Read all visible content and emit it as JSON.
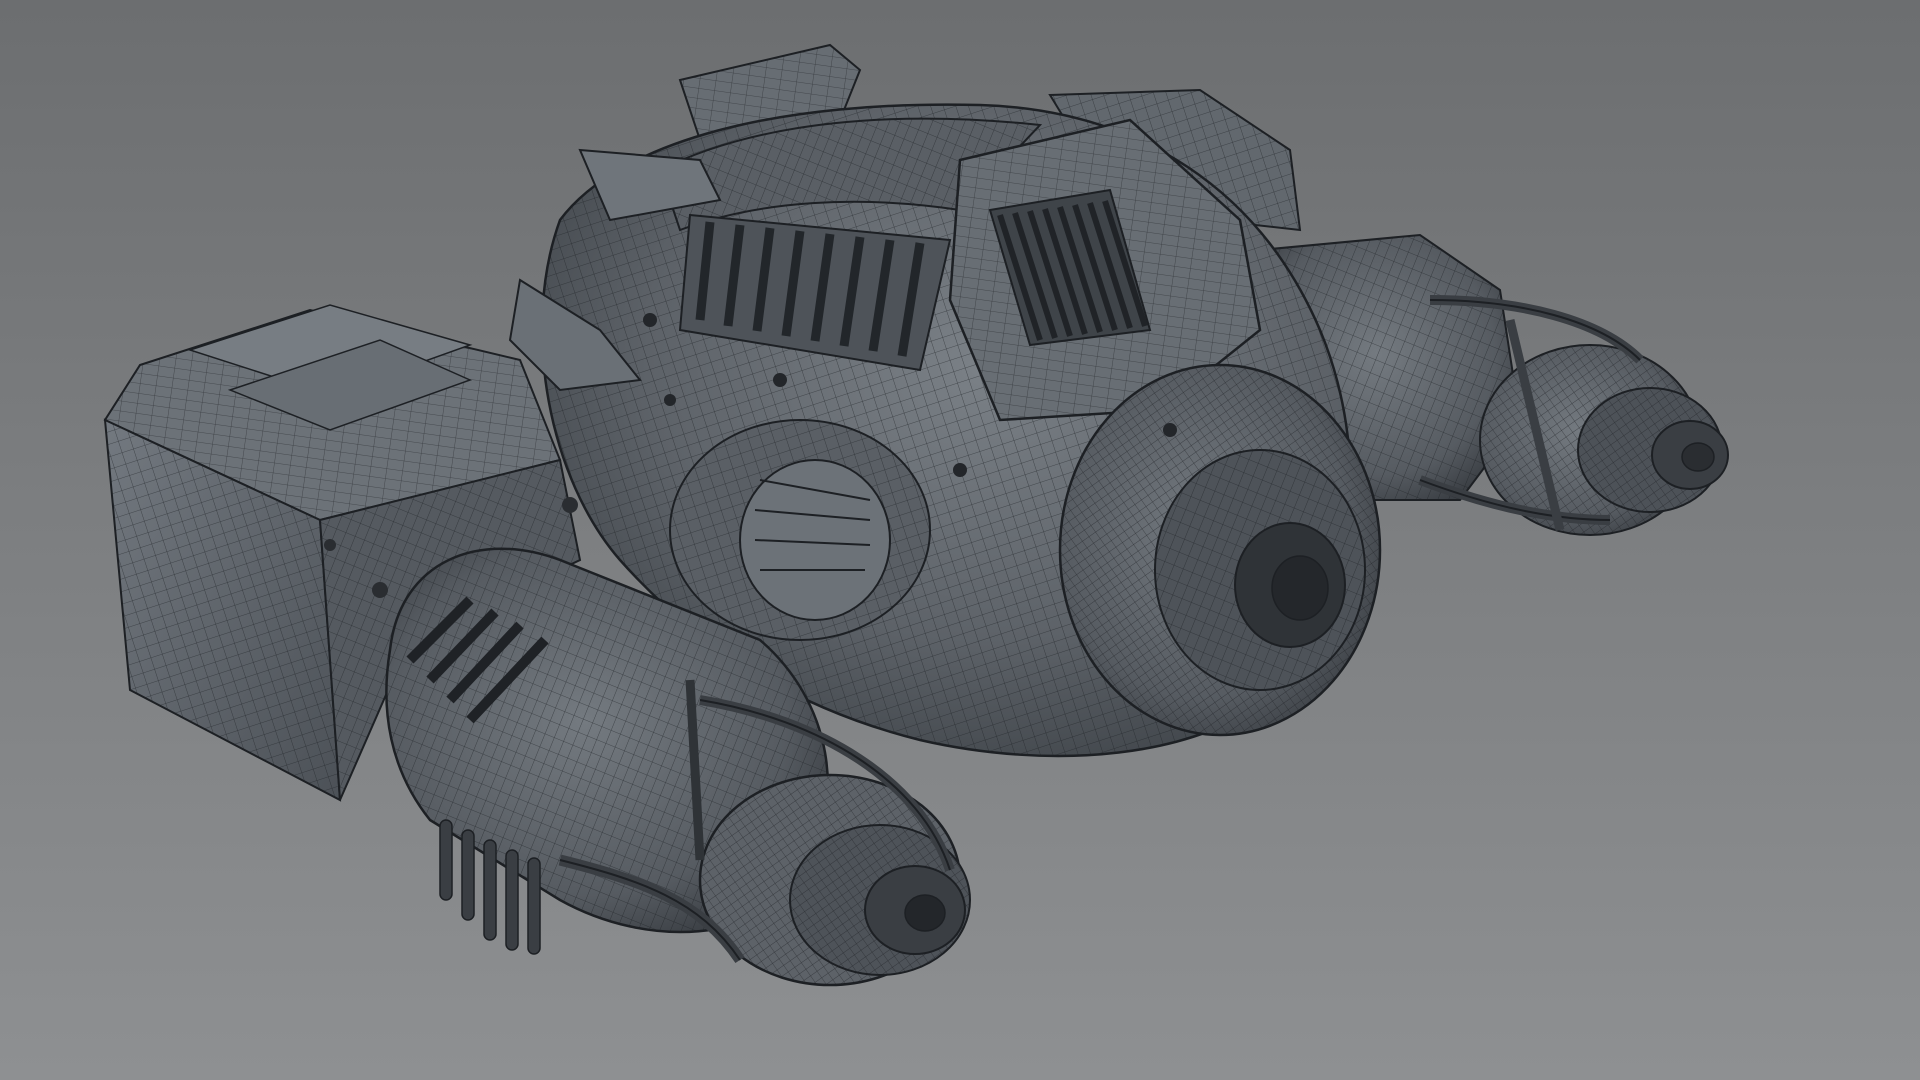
{
  "viewport": {
    "description_label": "",
    "background": {
      "top": "#6c6e70",
      "bottom": "#8e9092"
    }
  },
  "model": {
    "shading": "wireframe-on-shaded",
    "surface_color": "#5d6268",
    "surface_dark": "#3f4449",
    "surface_light": "#7b8187",
    "wire_color": "#1d2024"
  }
}
